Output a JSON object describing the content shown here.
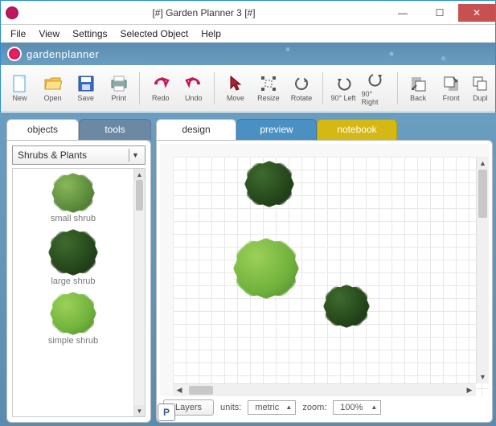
{
  "window": {
    "title": "[#] Garden Planner 3 [#]"
  },
  "menu": {
    "file": "File",
    "view": "View",
    "settings": "Settings",
    "selected_object": "Selected Object",
    "help": "Help"
  },
  "brand": {
    "text": "gardenplanner"
  },
  "toolbar": {
    "new": "New",
    "open": "Open",
    "save": "Save",
    "print": "Print",
    "redo": "Redo",
    "undo": "Undo",
    "move": "Move",
    "resize": "Resize",
    "rotate": "Rotate",
    "rot_left": "90° Left",
    "rot_right": "90° Right",
    "back": "Back",
    "front": "Front",
    "dupl": "Dupl"
  },
  "left": {
    "tab_objects": "objects",
    "tab_tools": "tools",
    "category": "Shrubs & Plants",
    "items": [
      {
        "label": "small shrub"
      },
      {
        "label": "large shrub"
      },
      {
        "label": "simple shrub"
      }
    ]
  },
  "right": {
    "tab_design": "design",
    "tab_preview": "preview",
    "tab_notebook": "notebook"
  },
  "status": {
    "layers": "Layers",
    "units_label": "units:",
    "units_value": "metric",
    "zoom_label": "zoom:",
    "zoom_value": "100%",
    "p": "P"
  }
}
